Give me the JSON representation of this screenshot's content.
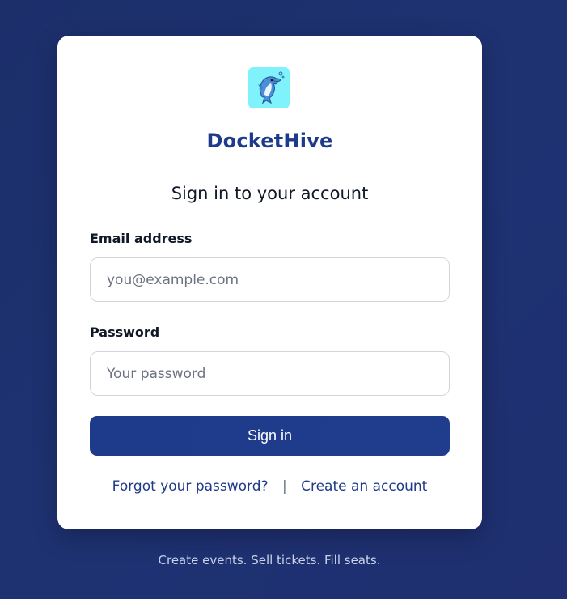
{
  "brand": {
    "name": "DocketHive",
    "logo_icon": "dolphin-icon",
    "logo_bg": "#7ff2fb"
  },
  "form": {
    "heading": "Sign in to your account",
    "email": {
      "label": "Email address",
      "placeholder": "you@example.com",
      "value": ""
    },
    "password": {
      "label": "Password",
      "placeholder": "Your password",
      "value": ""
    },
    "submit_label": "Sign in"
  },
  "links": {
    "forgot": "Forgot your password?",
    "separator": "|",
    "create": "Create an account"
  },
  "tagline": "Create events. Sell tickets. Fill seats.",
  "colors": {
    "primary": "#1e3a8a",
    "background": "#1e3272",
    "card": "#ffffff"
  }
}
